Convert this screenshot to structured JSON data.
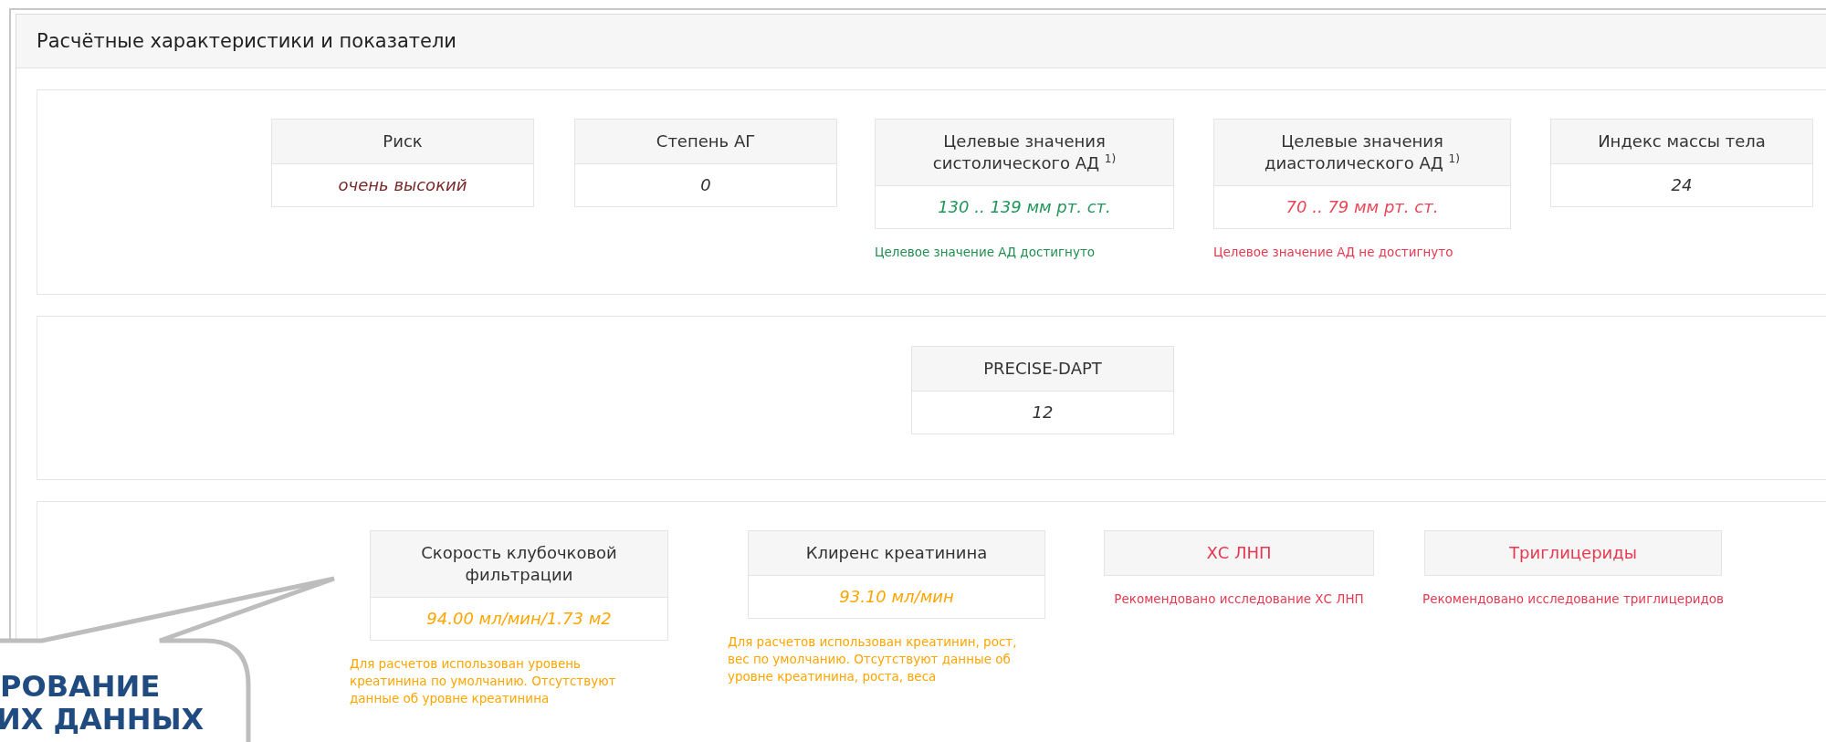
{
  "panel": {
    "title": "Расчётные характеристики и показатели"
  },
  "sections": [
    {
      "cards": [
        {
          "title": "Риск",
          "value": {
            "text": "очень высокий",
            "color": "#7a2a2a"
          }
        },
        {
          "title": "Степень АГ",
          "value": {
            "text": "0",
            "color": "#333333"
          }
        },
        {
          "title": "Целевые значения систолического АД $^{1)}$",
          "value": {
            "text": "130 .. 139 мм рт. ст.",
            "color": "#22965a"
          },
          "note": {
            "text": "Целевое значение АД достигнуто",
            "color": "#1e8f4e"
          }
        },
        {
          "title": "Целевые значения диастолического АД $^{1)}$",
          "value": {
            "text": "70 .. 79 мм рт. ст.",
            "color": "#ee4458"
          },
          "note": {
            "text": "Целевое значение АД не достигнуто",
            "color": "#e8384f"
          }
        },
        {
          "title": "Индекс массы тела",
          "value": {
            "text": "24",
            "color": "#333333"
          }
        }
      ]
    },
    {
      "cards": [
        {
          "title": "PRECISE-DAPT",
          "value": {
            "text": "12",
            "color": "#333333"
          }
        }
      ]
    },
    {
      "cards": [
        {
          "title": "Скорость клубочковой фильтрации",
          "value": {
            "text": "94.00 мл/мин/1.73 м2",
            "color": "#ffa500"
          },
          "note": {
            "text": "Для расчетов использован уровень креатинина по умолчанию. Отсутствуют данные об уровне креатинина",
            "color": "#ffa500"
          }
        },
        {
          "title": "Клиренс креатинина",
          "value": {
            "text": "93.10 мл/мин",
            "color": "#ffa500"
          },
          "note": {
            "text": "Для расчетов использован креатинин, рост, вес по умолчанию. Отсутствуют данные об уровне креатинина, роста, веса",
            "color": "#ffa500"
          }
        },
        {
          "title": "ХС ЛНП",
          "color": "#e8384f",
          "note": {
            "text": "Рекомендовано исследование ХС ЛНП",
            "color": "#e8384f"
          }
        },
        {
          "title": "Триглицериды",
          "color": "#e8384f",
          "note": {
            "text": "Рекомендовано исследование триглицеридов",
            "color": "#e8384f"
          }
        }
      ]
    }
  ],
  "callout": {
    "lines": [
      "РОВАНИЕ",
      "ИХ ДАННЫХ"
    ]
  }
}
